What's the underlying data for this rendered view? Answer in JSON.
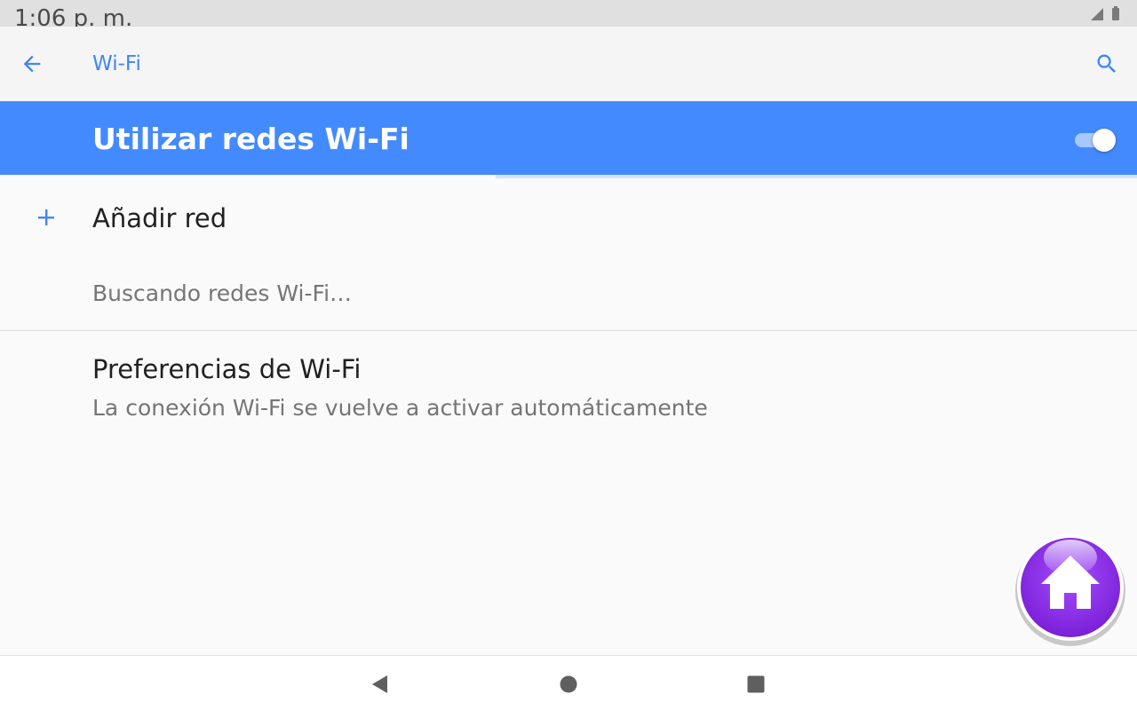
{
  "status_bar": {
    "time": "1:06 p. m.",
    "icons": [
      "signal-icon",
      "battery-icon"
    ]
  },
  "toolbar": {
    "back_icon": "arrow-left-icon",
    "title": "Wi-Fi",
    "search_icon": "search-icon"
  },
  "master_switch": {
    "label": "Utilizar redes Wi-Fi",
    "checked": true
  },
  "add_network": {
    "icon": "plus-icon",
    "label": "Añadir red"
  },
  "scanning": {
    "text": "Buscando redes Wi-Fi…"
  },
  "preferences": {
    "title": "Preferencias de Wi-Fi",
    "summary": "La conexión Wi-Fi se vuelve a activar automáticamente"
  },
  "floating_button": {
    "icon": "home-icon"
  },
  "nav_bar": {
    "back_icon": "nav-back-icon",
    "home_icon": "nav-home-icon",
    "recents_icon": "nav-recents-icon"
  },
  "colors": {
    "accent": "#4285f4",
    "master_bar": "#448aff",
    "primary_text": "#212121",
    "secondary_text": "#757575",
    "bubble": "#8a2be2"
  }
}
